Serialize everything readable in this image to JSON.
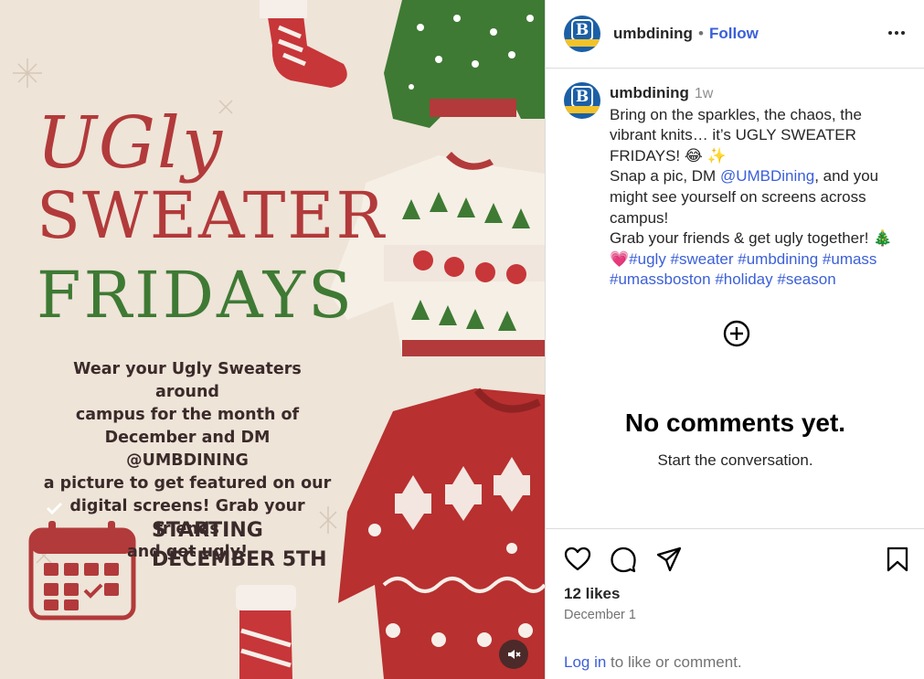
{
  "post_image": {
    "title_line1": "UGly",
    "title_line2": "SWEATER",
    "title_line3": "FRIDAYS",
    "body_lines": [
      "Wear your Ugly Sweaters around",
      "campus for the month of",
      "December and DM @UMBDINING",
      "a picture to get featured on our",
      "digital screens! Grab your friends",
      "and get ugly!"
    ],
    "start_line1": "STARTING",
    "start_line2": "DECEMBER 5TH",
    "mute_icon": "muted-speaker-icon"
  },
  "header": {
    "username": "umbdining",
    "separator": "•",
    "follow_label": "Follow",
    "more_icon": "more-options-icon"
  },
  "caption": {
    "username": "umbdining",
    "time": "1w",
    "line1": "Bring on the sparkles, the chaos, the vibrant knits… it’s UGLY SWEATER FRIDAYS! 😂 ✨",
    "line2_pre": "Snap a pic, DM ",
    "line2_mention": "@UMBDining",
    "line2_post": ", and you might see yourself on screens across campus!",
    "line3": "Grab your friends & get ugly together! 🎄",
    "heart_emoji": "💗",
    "hashtags": [
      "#ugly",
      "#sweater",
      "#umbdining",
      "#umass",
      "#umassboston",
      "#holiday",
      "#season"
    ]
  },
  "comments": {
    "empty_title": "No comments yet.",
    "empty_subtitle": "Start the conversation."
  },
  "actions": {
    "likes": "12 likes",
    "date": "December 1",
    "login_link": "Log in",
    "login_rest": " to like or comment."
  },
  "colors": {
    "link_blue": "#3b5fd9",
    "title_red": "#b23a3a",
    "title_green": "#3f7a35",
    "poster_bg": "#efe4d8"
  }
}
